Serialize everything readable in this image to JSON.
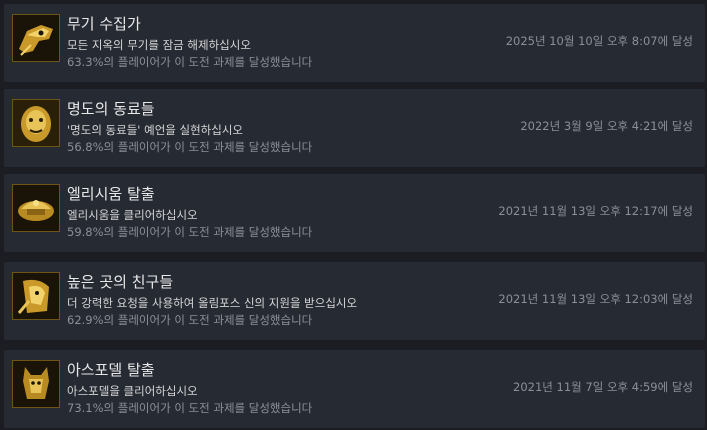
{
  "achievements": [
    {
      "title": "무기 수집가",
      "description": "모든 지옥의 무기를 잠금 해제하십시오",
      "percent": "63.3%의 플레이어가 이 도전 과제를 달성했습니다",
      "unlocked": "2025년 10월 10일 오후 8:07에 달성",
      "icon": "skull-weapon-icon"
    },
    {
      "title": "명도의 동료들",
      "description": "'명도의 동료들' 예언을 실현하십시오",
      "percent": "56.8%의 플레이어가 이 도전 과제를 달성했습니다",
      "unlocked": "2022년 3월 9일 오후 4:21에 달성",
      "icon": "companion-face-icon"
    },
    {
      "title": "엘리시움 탈출",
      "description": "엘리시움을 클리어하십시오",
      "percent": "59.8%의 플레이어가 이 도전 과제를 달성했습니다",
      "unlocked": "2021년 11월 13일 오후 12:17에 달성",
      "icon": "elysium-helmet-icon"
    },
    {
      "title": "높은 곳의 친구들",
      "description": "더 강력한 요청을 사용하여 올림포스 신의 지원을 받으십시오",
      "percent": "62.9%의 플레이어가 이 도전 과제를 달성했습니다",
      "unlocked": "2021년 11월 13일 오후 12:03에 달성",
      "icon": "olympian-god-icon"
    },
    {
      "title": "아스포델 탈출",
      "description": "아스포델을 클리어하십시오",
      "percent": "73.1%의 플레이어가 이 도전 과제를 달성했습니다",
      "unlocked": "2021년 11월 7일 오후 4:59에 달성",
      "icon": "asphodel-creature-icon"
    }
  ],
  "colors": {
    "background": "#1b1d22",
    "row": "#262a33",
    "title": "#e8e8e8",
    "muted": "#8a9099",
    "gold": "#d9b13c"
  }
}
